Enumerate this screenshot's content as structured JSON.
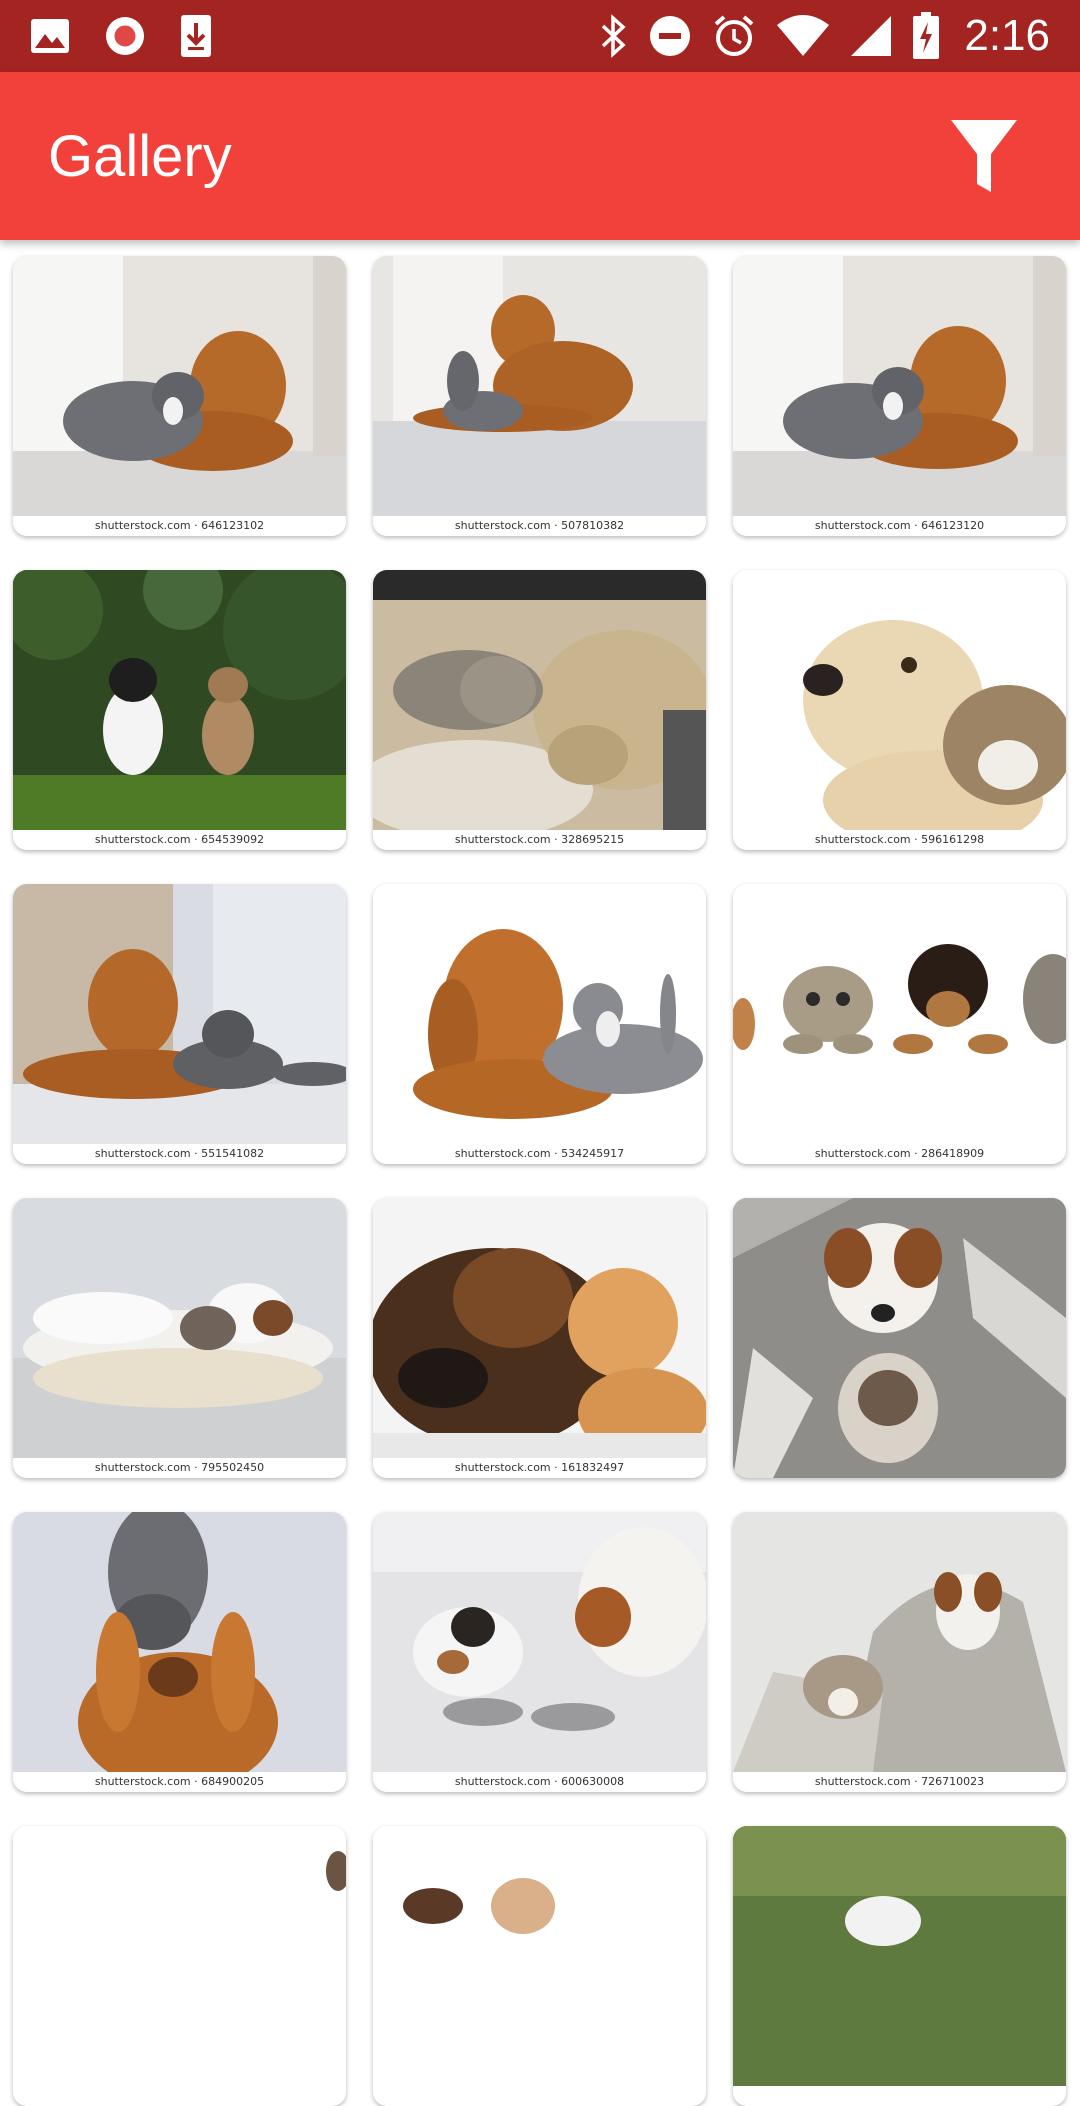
{
  "status_bar": {
    "time": "2:16",
    "left_icons": [
      "image-icon",
      "record-icon",
      "download-icon"
    ],
    "right_icons": [
      "bluetooth-icon",
      "do-not-disturb-icon",
      "alarm-icon",
      "wifi-icon",
      "signal-icon",
      "battery-charging-icon"
    ]
  },
  "app_bar": {
    "title": "Gallery",
    "filter_icon": "filter-icon",
    "color": "#f2403a"
  },
  "status_bar_color": "#a32420",
  "gallery": {
    "items": [
      {
        "caption": "shutterstock.com · 646123102",
        "subject": "golden retriever and grey cat cuddling"
      },
      {
        "caption": "shutterstock.com · 507810382",
        "subject": "golden retriever playing with grey cat"
      },
      {
        "caption": "shutterstock.com · 646123120",
        "subject": "golden retriever and grey cat cuddling"
      },
      {
        "caption": "shutterstock.com · 654539092",
        "subject": "puppy and kitten on grass"
      },
      {
        "caption": "shutterstock.com · 328695215",
        "subject": "kitten sleeping on dog"
      },
      {
        "caption": "shutterstock.com · 596161298",
        "subject": "labrador and tabby cat"
      },
      {
        "caption": "shutterstock.com · 551541082",
        "subject": "golden retriever and grey cat lying"
      },
      {
        "caption": "shutterstock.com · 534245917",
        "subject": "spaniel and grey cat"
      },
      {
        "caption": "shutterstock.com · 286418909",
        "subject": "cats and puppy over banner"
      },
      {
        "caption": "shutterstock.com · 795502450",
        "subject": "cat and terrier sleeping"
      },
      {
        "caption": "shutterstock.com · 161832497",
        "subject": "german shepherd and ginger cat"
      },
      {
        "caption": "",
        "subject": "terrier and cat under blanket"
      },
      {
        "caption": "shutterstock.com · 684900205",
        "subject": "grey cat and dog from above"
      },
      {
        "caption": "shutterstock.com · 600630008",
        "subject": "cat and dog eating from bowls"
      },
      {
        "caption": "shutterstock.com · 726710023",
        "subject": "cat and terrier in blanket"
      },
      {
        "caption": "",
        "subject": "partially visible"
      },
      {
        "caption": "",
        "subject": "partially visible"
      },
      {
        "caption": "",
        "subject": "partially visible"
      }
    ]
  }
}
